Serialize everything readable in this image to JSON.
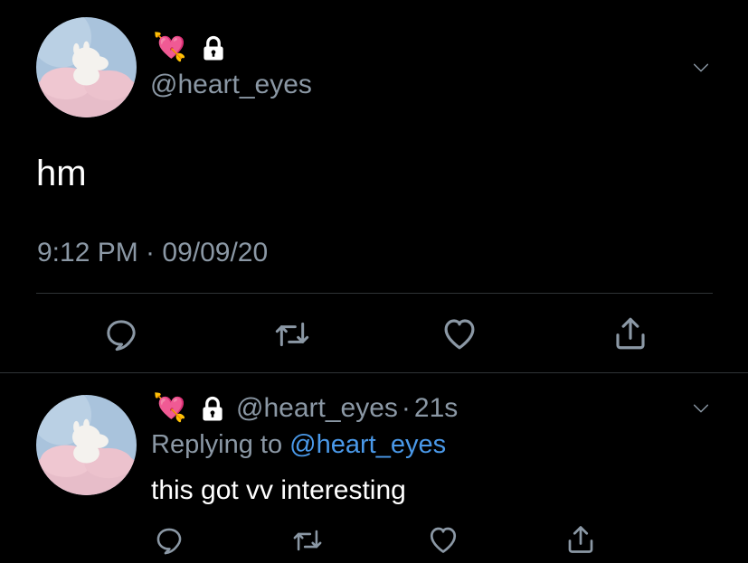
{
  "colors": {
    "background": "#000000",
    "text": "#ffffff",
    "muted": "#8b98a5",
    "link": "#4a99e9",
    "divider": "#2f3336"
  },
  "main_tweet": {
    "author_emoji": "💘",
    "protected_icon": "lock-icon",
    "handle": "@heart_eyes",
    "text": "hm",
    "timestamp": "9:12 PM · 09/09/20",
    "actions": [
      "reply-icon",
      "retweet-icon",
      "like-icon",
      "share-icon"
    ]
  },
  "reply_tweet": {
    "author_emoji": "💘",
    "protected_icon": "lock-icon",
    "handle": "@heart_eyes",
    "separator": "·",
    "age": "21s",
    "replying_prefix": "Replying to",
    "replying_handle": "@heart_eyes",
    "text": "this got vv interesting",
    "actions": [
      "reply-icon",
      "retweet-icon",
      "like-icon",
      "share-icon"
    ]
  }
}
